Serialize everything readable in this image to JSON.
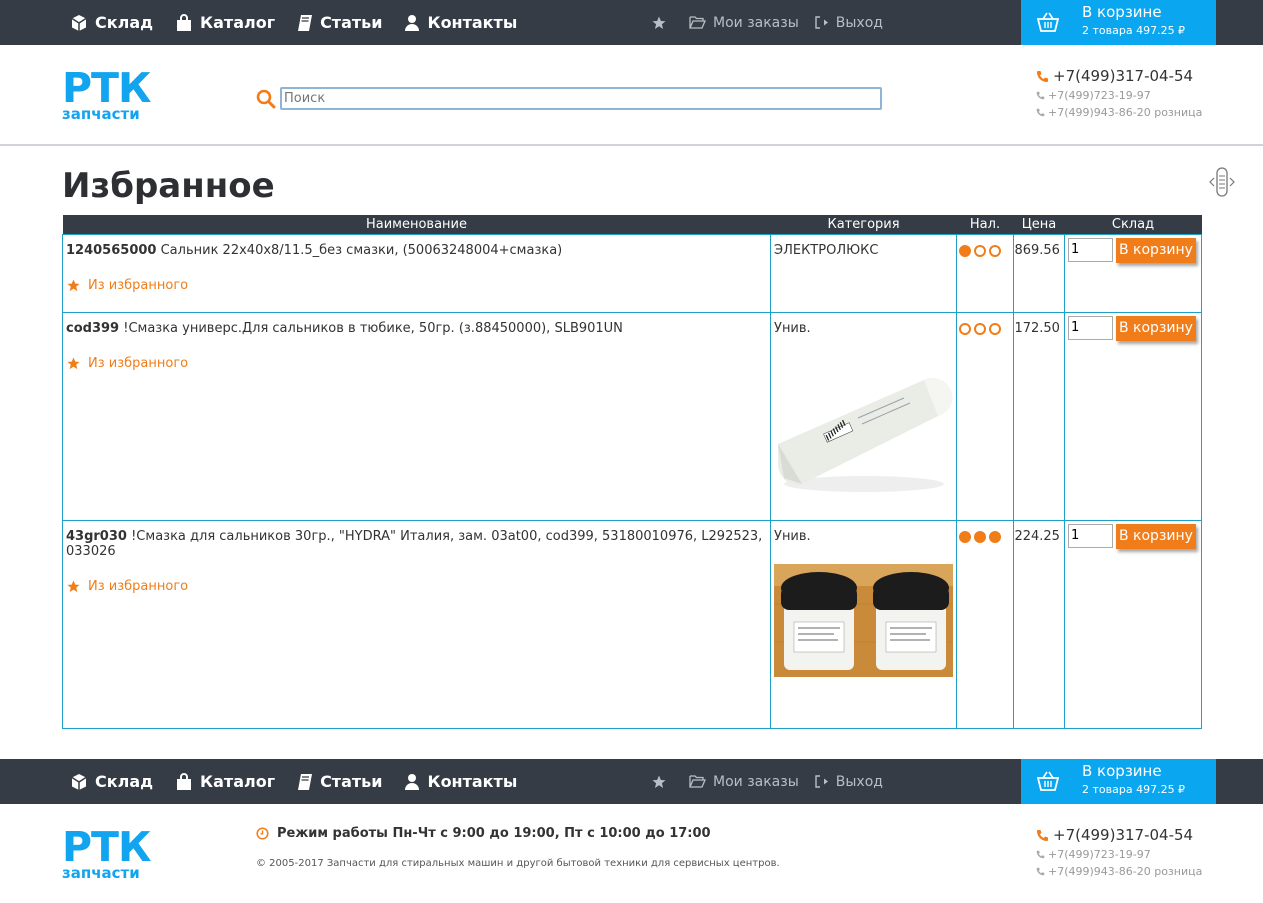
{
  "nav": {
    "main": [
      "Склад",
      "Каталог",
      "Статьи",
      "Контакты"
    ],
    "orders": "Мои заказы",
    "logout": "Выход",
    "cart_title": "В корзине",
    "cart_summary": "2 товара 497.25 ₽"
  },
  "header": {
    "logo_big": "РТК",
    "logo_small": "запчасти",
    "search_placeholder": "Поиск",
    "phone_main": "+7(499)317-04-54",
    "phone_2": "+7(499)723-19-97",
    "phone_3": "+7(499)943-86-20 розница"
  },
  "page": {
    "title": "Избранное"
  },
  "table": {
    "headers": [
      "Наименование",
      "Категория",
      "Нал.",
      "Цена",
      "Склад"
    ],
    "fav_label": "Из избранного",
    "buy_label": "В корзину",
    "rows": [
      {
        "code": "1240565000",
        "name": "Сальник 22x40x8/11.5_без смазки, (50063248004+смазка)",
        "category": "ЭЛЕКТРОЛЮКС",
        "availability": 1,
        "price": "869.56",
        "qty": "1",
        "image": "none"
      },
      {
        "code": "cod399",
        "name": "!Смазка универс.Для сальников в тюбике, 50гр. (з.88450000), SLB901UN",
        "category": "Унив.",
        "availability": 0,
        "price": "172.50",
        "qty": "1",
        "image": "tube"
      },
      {
        "code": "43gr030",
        "name": "!Смазка для сальников 30гр., \"HYDRA\" Италия, зам. 03at00, cod399, 53180010976, L292523, 033026",
        "category": "Унив.",
        "availability": 3,
        "price": "224.25",
        "qty": "1",
        "image": "jars"
      }
    ]
  },
  "footer": {
    "hours": "Режим работы Пн-Чт с 9:00 до 19:00, Пт с 10:00 до 17:00",
    "copyright": "© 2005-2017 Запчасти для стиральных машин и другой бытовой техники для сервисных центров."
  },
  "colors": {
    "nav_bg": "#353c45",
    "cart_bg": "#0aa6f0",
    "accent_orange": "#f07d1a",
    "logo_blue": "#12a4ee",
    "table_border": "#1ea0c8"
  }
}
